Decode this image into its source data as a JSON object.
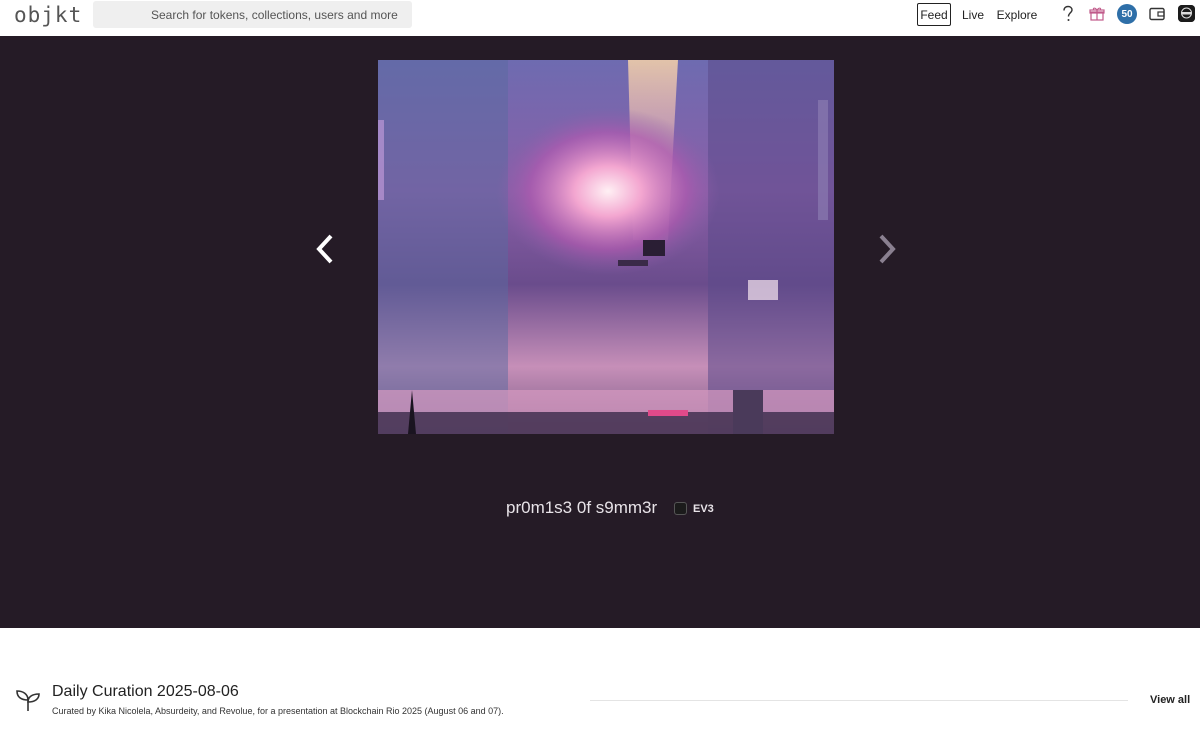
{
  "header": {
    "logo": "objkt",
    "search_placeholder": "Search for tokens, collections, users and more",
    "nav": {
      "feed": "Feed",
      "live": "Live",
      "explore": "Explore"
    },
    "balance_badge": "50",
    "icons": [
      "help-icon",
      "gift-icon",
      "wallet-icon",
      "user-avatar"
    ]
  },
  "hero": {
    "token_title": "pr0m1s3 0f s9mm3r",
    "creator_name": "EV3",
    "icons": [
      "chevron-left-icon",
      "chevron-right-icon"
    ]
  },
  "curation": {
    "title": "Daily Curation 2025-08-06",
    "subtitle": "Curated by Kika Nicolela, Absurdeity, and Revolue, for a presentation at Blockchain Rio 2025 (August 06 and 07).",
    "view_all": "View all",
    "icon": "sprout-icon"
  },
  "colors": {
    "hero_bg": "#251b26",
    "accent_badge": "#2e6fa8",
    "header_bg": "#ffffff"
  }
}
